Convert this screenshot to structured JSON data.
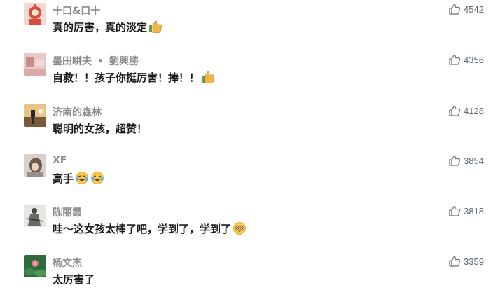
{
  "comments": [
    {
      "name": "十口&口十",
      "name2": "",
      "text": "真的厉害，真的淡定",
      "emoji": [
        "thumbs-up-emoji"
      ],
      "likes": "4542",
      "avatar": "avatar-red-character"
    },
    {
      "name": "墨田畊夫",
      "name2": "劉興勝",
      "text": "自救！！孩子你挺厉害！捧！！",
      "emoji": [
        "thumbs-up-emoji"
      ],
      "likes": "4356",
      "avatar": "avatar-pink-photo"
    },
    {
      "name": "济南的森林",
      "name2": "",
      "text": "聪明的女孩，超赞！",
      "emoji": [],
      "likes": "4128",
      "avatar": "avatar-sunset-camera"
    },
    {
      "name": "XF",
      "name2": "",
      "text": "高手",
      "emoji": [
        "laughing-tears-emoji",
        "laughing-tears-emoji"
      ],
      "likes": "3854",
      "avatar": "avatar-girl-portrait"
    },
    {
      "name": "陈丽霞",
      "name2": "",
      "text": "哇～这女孩太棒了吧，学到了，学到了",
      "emoji": [
        "flushed-face-emoji"
      ],
      "likes": "3818",
      "avatar": "avatar-sketch-figure"
    },
    {
      "name": "杨文杰",
      "name2": "",
      "text": "太厉害了",
      "emoji": [],
      "likes": "3359",
      "avatar": "avatar-lotus-pond"
    }
  ],
  "icons": {
    "like": "thumbs-up-outline-icon"
  },
  "colors": {
    "name": "#8a8a8a",
    "text": "#1a1a1a",
    "likes": "#5d6572"
  }
}
